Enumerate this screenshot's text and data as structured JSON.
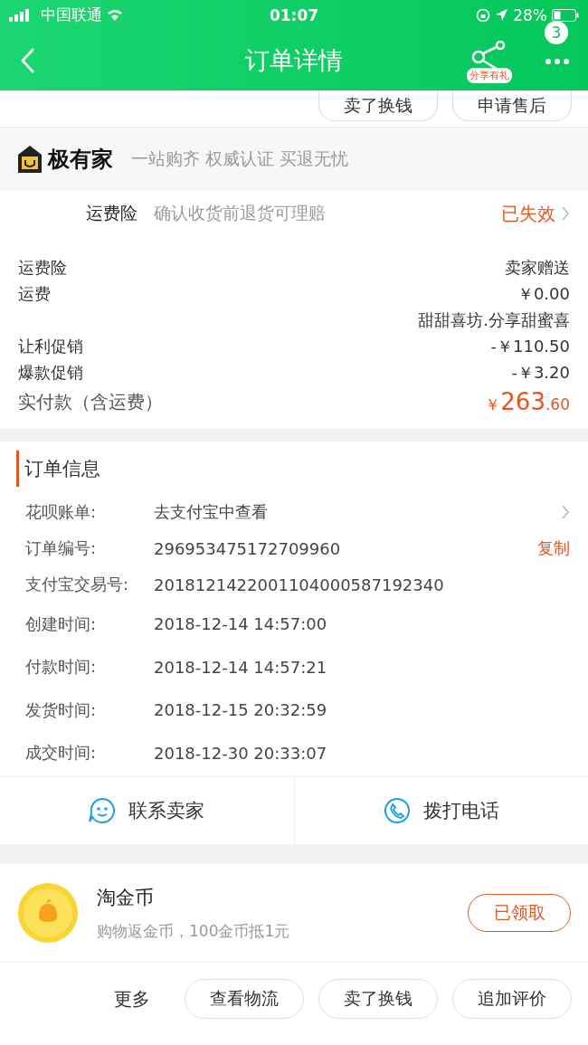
{
  "status_bar": {
    "carrier": "中国联通",
    "time": "01:07",
    "battery": "28%"
  },
  "nav": {
    "title": "订单详情",
    "share_label": "分享有礼",
    "badge": "3"
  },
  "top_actions": [
    "卖了换钱",
    "申请售后"
  ],
  "brand": {
    "name": "极有家",
    "slogan": "一站购齐 权威认证 买退无忧"
  },
  "insurance": {
    "label": "运费险",
    "desc": "确认收货前退货可理赔",
    "status": "已失效"
  },
  "price_rows": [
    {
      "label": "运费险",
      "value": "卖家赠送"
    },
    {
      "label": "运费",
      "value": "￥0.00"
    },
    {
      "label": "",
      "value": "甜甜喜坊.分享甜蜜喜"
    },
    {
      "label": "让利促销",
      "value": "-￥110.50"
    },
    {
      "label": "爆款促销",
      "value": "-￥3.20"
    }
  ],
  "total": {
    "label": "实付款（含运费）",
    "currency": "￥",
    "integer": "263",
    "decimal": ".60"
  },
  "order_info": {
    "title": "订单信息",
    "rows": [
      {
        "label": "花呗账单:",
        "value": "去支付宝中查看",
        "arrow": true
      },
      {
        "label": "订单编号:",
        "value": "296953475172709960",
        "action": "复制"
      },
      {
        "label": "支付宝交易号:",
        "value": "2018121422001104000587192340"
      },
      {
        "label": "创建时间:",
        "value": "2018-12-14 14:57:00"
      },
      {
        "label": "付款时间:",
        "value": "2018-12-14 14:57:21"
      },
      {
        "label": "发货时间:",
        "value": "2018-12-15 20:32:59"
      },
      {
        "label": "成交时间:",
        "value": "2018-12-30 20:33:07"
      }
    ]
  },
  "contact": [
    {
      "kind": "chat",
      "label": "联系卖家"
    },
    {
      "kind": "phone",
      "label": "拨打电话"
    }
  ],
  "coins": {
    "title": "淘金币",
    "desc": "购物返金币，100金币抵1元",
    "button": "已领取"
  },
  "more": {
    "label": "更多",
    "buttons": [
      "查看物流",
      "卖了换钱",
      "追加评价"
    ]
  }
}
